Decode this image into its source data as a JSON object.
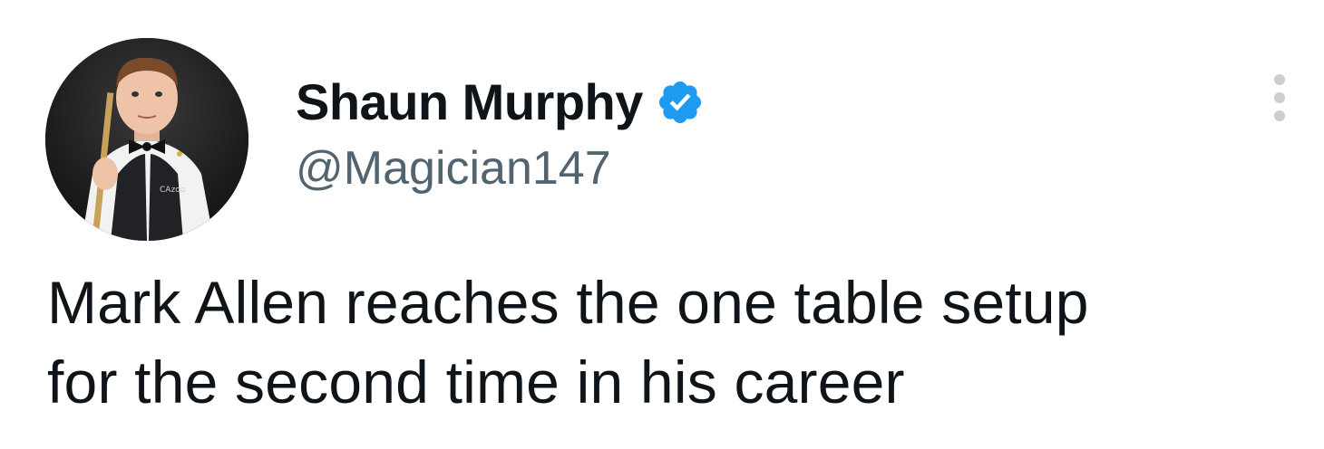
{
  "author": {
    "display_name": "Shaun Murphy",
    "handle": "@Magician147",
    "verified": true,
    "verified_color": "#1d9bf0"
  },
  "avatar": {
    "icon": "avatar-photo",
    "badge_text": "CAzoo"
  },
  "menu": {
    "icon": "more-vertical-icon"
  },
  "tweet": {
    "lines": [
      "Mark Allen reaches the one table setup",
      "for the second time in his career"
    ]
  },
  "colors": {
    "text_primary": "#0f1419",
    "text_secondary": "#536471",
    "menu_dots": "#c9ced2"
  }
}
